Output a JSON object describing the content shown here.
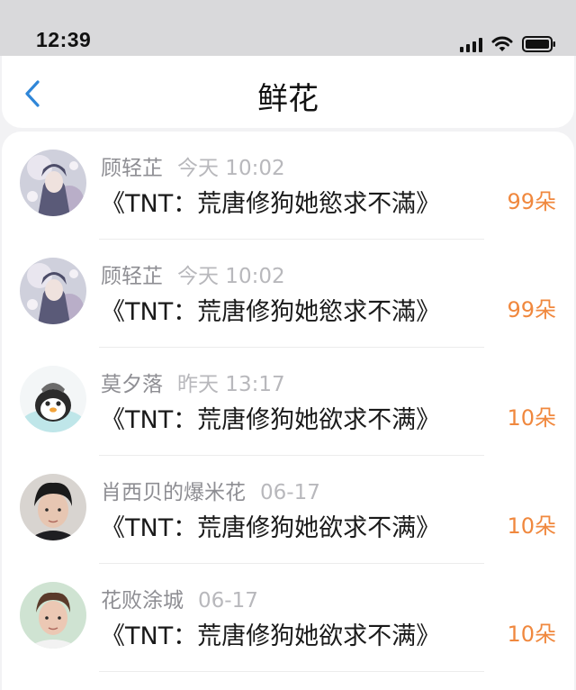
{
  "status_bar": {
    "time": "12:39",
    "icons": [
      "signal-icon",
      "wifi-icon",
      "battery-icon"
    ]
  },
  "nav": {
    "title": "鲜花",
    "back_icon": "chevron-left-icon",
    "accent": "#2f86d8"
  },
  "colors": {
    "amount": "#f0883e",
    "meta_text": "#8e8e93"
  },
  "rows": [
    {
      "name": "顾轻芷",
      "time": "今天 10:02",
      "title": "《TNT：荒唐修狗她慾求不滿》",
      "amount": "99朵",
      "avatar": "anime-avatar"
    },
    {
      "name": "顾轻芷",
      "time": "今天 10:02",
      "title": "《TNT：荒唐修狗她慾求不滿》",
      "amount": "99朵",
      "avatar": "anime-avatar"
    },
    {
      "name": "莫夕落",
      "time": "昨天 13:17",
      "title": "《TNT：荒唐修狗她欲求不满》",
      "amount": "10朵",
      "avatar": "penguin-avatar"
    },
    {
      "name": "肖西贝的爆米花",
      "time": "06-17",
      "title": "《TNT：荒唐修狗她欲求不满》",
      "amount": "10朵",
      "avatar": "boy-photo-avatar"
    },
    {
      "name": "花败涂城",
      "time": "06-17",
      "title": "《TNT：荒唐修狗她欲求不满》",
      "amount": "10朵",
      "avatar": "boy-photo-avatar"
    }
  ]
}
